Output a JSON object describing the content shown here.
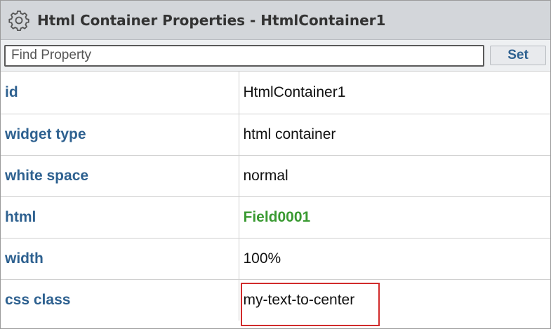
{
  "header": {
    "title": "Html Container Properties - HtmlContainer1",
    "icon": "gear-icon"
  },
  "search": {
    "placeholder": "Find Property",
    "value": "",
    "button_label": "Set"
  },
  "properties": [
    {
      "name": "id",
      "value": "HtmlContainer1"
    },
    {
      "name": "widget type",
      "value": "html container"
    },
    {
      "name": "white space",
      "value": "normal"
    },
    {
      "name": "html",
      "value": "Field0001"
    },
    {
      "name": "width",
      "value": "100%"
    },
    {
      "name": "css class",
      "value": "my-text-to-center"
    }
  ],
  "colors": {
    "label": "#2e6190",
    "link_value": "#3a9a32",
    "highlight": "#d12b2b",
    "header_bg": "#d3d6da"
  }
}
